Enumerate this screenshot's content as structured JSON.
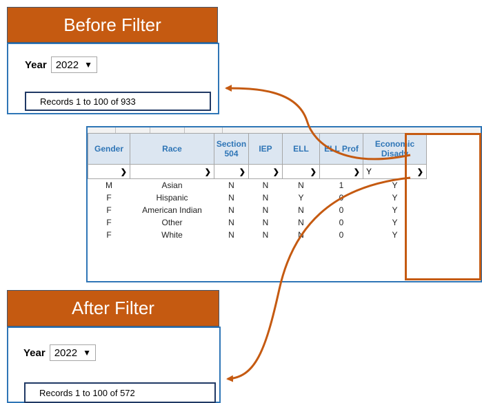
{
  "before": {
    "title": "Before Filter",
    "year_label": "Year",
    "year_value": "2022",
    "records_text": "Records 1 to 100 of 933"
  },
  "after": {
    "title": "After Filter",
    "year_label": "Year",
    "year_value": "2022",
    "records_text": "Records 1 to 100 of 572"
  },
  "grid": {
    "columns": [
      {
        "key": "gender",
        "label": "Gender",
        "filter": ""
      },
      {
        "key": "race",
        "label": "Race",
        "filter": ""
      },
      {
        "key": "section504",
        "label": "Section 504",
        "filter": ""
      },
      {
        "key": "iep",
        "label": "IEP",
        "filter": ""
      },
      {
        "key": "ell",
        "label": "ELL",
        "filter": ""
      },
      {
        "key": "ellprof",
        "label": "ELL Prof",
        "filter": ""
      },
      {
        "key": "econ",
        "label": "Economic Disadv",
        "filter": "Y"
      }
    ],
    "rows": [
      [
        "M",
        "Asian",
        "N",
        "N",
        "N",
        "1",
        "Y"
      ],
      [
        "F",
        "Hispanic",
        "N",
        "N",
        "Y",
        "0",
        "Y"
      ],
      [
        "F",
        "American Indian",
        "N",
        "N",
        "N",
        "0",
        "Y"
      ],
      [
        "F",
        "Other",
        "N",
        "N",
        "N",
        "0",
        "Y"
      ],
      [
        "F",
        "White",
        "N",
        "N",
        "N",
        "0",
        "Y"
      ]
    ]
  },
  "colors": {
    "accent_orange": "#c55a11",
    "panel_blue": "#2e75b6",
    "records_border": "#1f3864",
    "header_bg": "#dce6f1",
    "filter_active": "#ffd966"
  }
}
